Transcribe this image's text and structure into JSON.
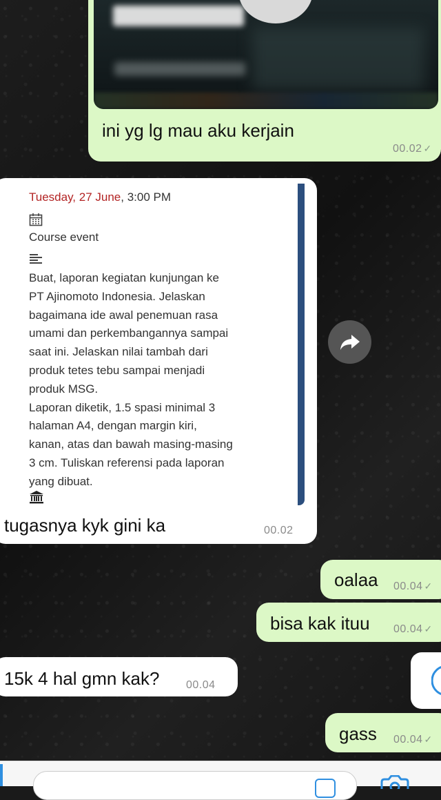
{
  "messages": {
    "image_caption": {
      "text": "ini yg lg mau aku  kerjain",
      "time": "00.02"
    },
    "course_event": {
      "date": "Tuesday, 27 June",
      "time_suffix": ", 3:00 PM",
      "type_label": "Course event",
      "description": [
        "Buat, laporan kegiatan kunjungan ke",
        "PT Ajinomoto Indonesia. Jelaskan",
        "bagaimana ide awal penemuan rasa",
        "umami dan perkembangannya sampai",
        "saat ini. Jelaskan nilai tambah dari",
        "produk tetes tebu sampai menjadi",
        "produk MSG.",
        "Laporan diketik, 1.5 spasi minimal 3",
        "halaman A4, dengan margin kiri,",
        "kanan, atas dan bawah masing-masing",
        "3 cm. Tuliskan referensi pada laporan",
        "yang dibuat."
      ],
      "caption": "tugasnya kyk gini ka",
      "time": "00.02"
    },
    "oalaa": {
      "text": "oalaa",
      "time": "00.04"
    },
    "bisa": {
      "text": "bisa kak ituu",
      "time": "00.04"
    },
    "price": {
      "text": "15k 4 hal gmn kak?",
      "time": "00.04"
    },
    "gass": {
      "text": "gass",
      "time": "00.04"
    }
  },
  "icons": {
    "download": "arrow-down-icon",
    "share": "share-forward-icon",
    "calendar": "calendar-icon",
    "description": "text-lines-icon",
    "location": "building-icon",
    "read": "check-icon"
  },
  "colors": {
    "outgoing": "#dcf8c6",
    "incoming": "#ffffff",
    "date_red": "#b32424",
    "card_accent": "#2c4f7e"
  }
}
